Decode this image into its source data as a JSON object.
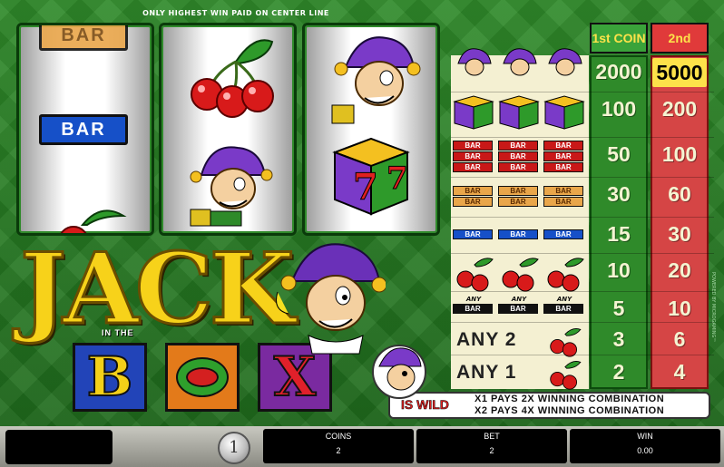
{
  "notice": "ONLY HIGHEST WIN PAID ON CENTER LINE",
  "reels": {
    "bar_label": "BAR",
    "seven_label": "7"
  },
  "logo": {
    "title": "JACK",
    "sub": "IN THE",
    "letters": [
      "B",
      "X"
    ]
  },
  "paytable": {
    "headers": [
      "1st COIN",
      "2nd COIN"
    ],
    "rows": [
      {
        "symbol": "jester x3",
        "coin1": "2000",
        "coin2": "5000"
      },
      {
        "symbol": "seven box x3",
        "coin1": "100",
        "coin2": "200"
      },
      {
        "symbol": "triple bar x3",
        "coin1": "50",
        "coin2": "100"
      },
      {
        "symbol": "double bar x3",
        "coin1": "30",
        "coin2": "60"
      },
      {
        "symbol": "single bar x3",
        "coin1": "15",
        "coin2": "30"
      },
      {
        "symbol": "cherry x3",
        "coin1": "10",
        "coin2": "20"
      },
      {
        "symbol": "any bar x3",
        "coin1": "5",
        "coin2": "10"
      },
      {
        "symbol": "any 2 cherry",
        "coin1": "3",
        "coin2": "6"
      },
      {
        "symbol": "any 1 cherry",
        "coin1": "2",
        "coin2": "4"
      }
    ],
    "bar_text": "BAR",
    "any_text": "ANY",
    "any2": "ANY 2",
    "any1": "ANY 1"
  },
  "wild": {
    "label": "IS WILD",
    "line1": "X1 PAYS 2X WINNING COMBINATION",
    "line2": "X2 PAYS 4X WINNING COMBINATION"
  },
  "powered": "POWERED BY MICROGAMING™",
  "controls": {
    "coin_value": "1",
    "coins_label": "COINS",
    "coins_value": "2",
    "bet_label": "BET",
    "bet_value": "2",
    "win_label": "WIN",
    "win_value": "0.00"
  }
}
